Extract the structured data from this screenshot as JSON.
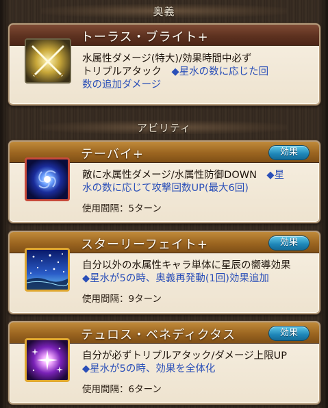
{
  "sections": {
    "ougi_label": "奥義",
    "ability_label": "アビリティ"
  },
  "ougi": {
    "title": "トーラス・ブライト+",
    "icon": "crossed-swords-icon",
    "desc_line1": "水属性ダメージ(特大)/効果時間中必ず",
    "desc_line2_plain": "トリプルアタック　",
    "desc_line2_star": "◆星水の数に応じた回",
    "desc_line3_star": "数の追加ダメージ"
  },
  "abilities": [
    {
      "title": "テーバイ+",
      "effect_label": "効果",
      "icon": "blue-vortex-icon",
      "desc_line1_plain": "敵に水属性ダメージ/水属性防御DOWN　",
      "desc_line1_star": "◆星",
      "desc_line2_star": "水の数に応じて攻撃回数UP(最大6回)",
      "cooldown": "使用間隔：5ターン"
    },
    {
      "title": "スターリーフェイト+",
      "effect_label": "効果",
      "icon": "starry-sky-icon",
      "desc_line1_plain": "自分以外の水属性キャラ単体に星辰の嚮導効果",
      "desc_line2_star": "◆星水が5の時、奥義再発動(1回)効果追加",
      "cooldown": "使用間隔：9ターン"
    },
    {
      "title": "テュロス・ベネディクタス",
      "effect_label": "効果",
      "icon": "purple-sparkle-icon",
      "desc_line1_plain": "自分が必ずトリプルアタック/ダメージ上限UP",
      "desc_line2_star": "◆星水が5の時、効果を全体化",
      "cooldown": "使用間隔：6ターン"
    }
  ]
}
